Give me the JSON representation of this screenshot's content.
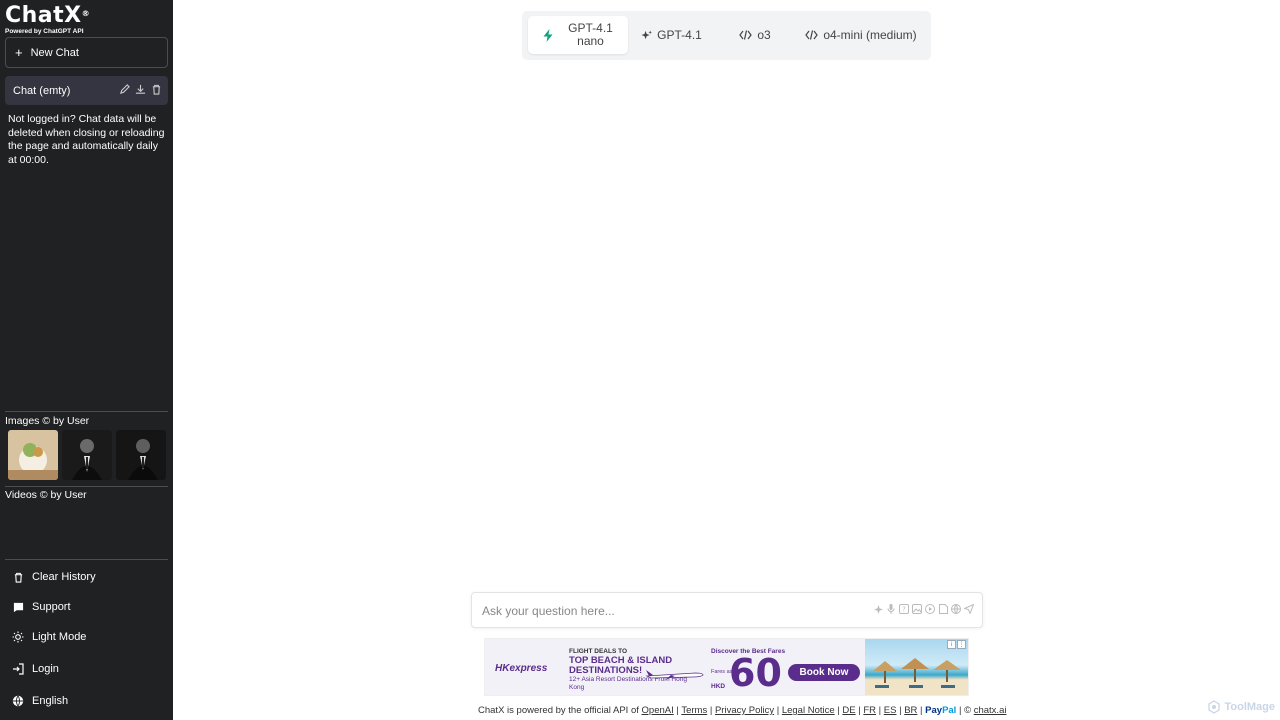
{
  "sidebar": {
    "logo": {
      "text": "ChatX",
      "trademark": "®",
      "subtitle": "Powered by ChatGPT API"
    },
    "new_chat_label": "New Chat",
    "chat_item": {
      "label": "Chat (emty)"
    },
    "notice": "Not logged in? Chat data will be deleted when closing or reloading the page and automatically daily at 00:00.",
    "images_label": "Images © by User",
    "videos_label": "Videos © by User",
    "menu": [
      {
        "label": "Clear History",
        "icon": "trash-icon"
      },
      {
        "label": "Support",
        "icon": "chat-bubble-icon"
      },
      {
        "label": "Light Mode",
        "icon": "sun-icon"
      },
      {
        "label": "Login",
        "icon": "login-icon"
      },
      {
        "label": "English",
        "icon": "globe-icon"
      }
    ]
  },
  "models": [
    {
      "label": "GPT-4.1 nano",
      "icon": "lightning-icon",
      "active": true
    },
    {
      "label": "GPT-4.1",
      "icon": "sparkle-icon",
      "active": false
    },
    {
      "label": "o3",
      "icon": "code-icon",
      "active": false
    },
    {
      "label": "o4-mini (medium)",
      "icon": "code-icon",
      "active": false
    }
  ],
  "input": {
    "placeholder": "Ask your question here..."
  },
  "ad": {
    "brand": "HKexpress",
    "line1": "FLIGHT DEALS TO",
    "line2": "TOP BEACH & ISLAND DESTINATIONS!",
    "line3": "12+ Asia Resort Destinations From Hong Kong",
    "discover": "Discover the Best Fares",
    "fares": "Fares as low as",
    "currency": "HKD",
    "price": "60",
    "cta": "Book Now"
  },
  "footer": {
    "text_prefix": "ChatX is powered by the official API of",
    "links": [
      "OpenAI",
      "Terms",
      "Privacy Policy",
      "Legal Notice",
      "DE",
      "FR",
      "ES",
      "BR"
    ],
    "paypal_a": "Pay",
    "paypal_b": "Pal",
    "copyright": "©",
    "domain": "chatx.ai"
  },
  "watermark": "ToolMage",
  "colors": {
    "sidebar_bg": "#202123",
    "accent_green": "#10a37f",
    "ad_purple": "#5a2d8c"
  }
}
